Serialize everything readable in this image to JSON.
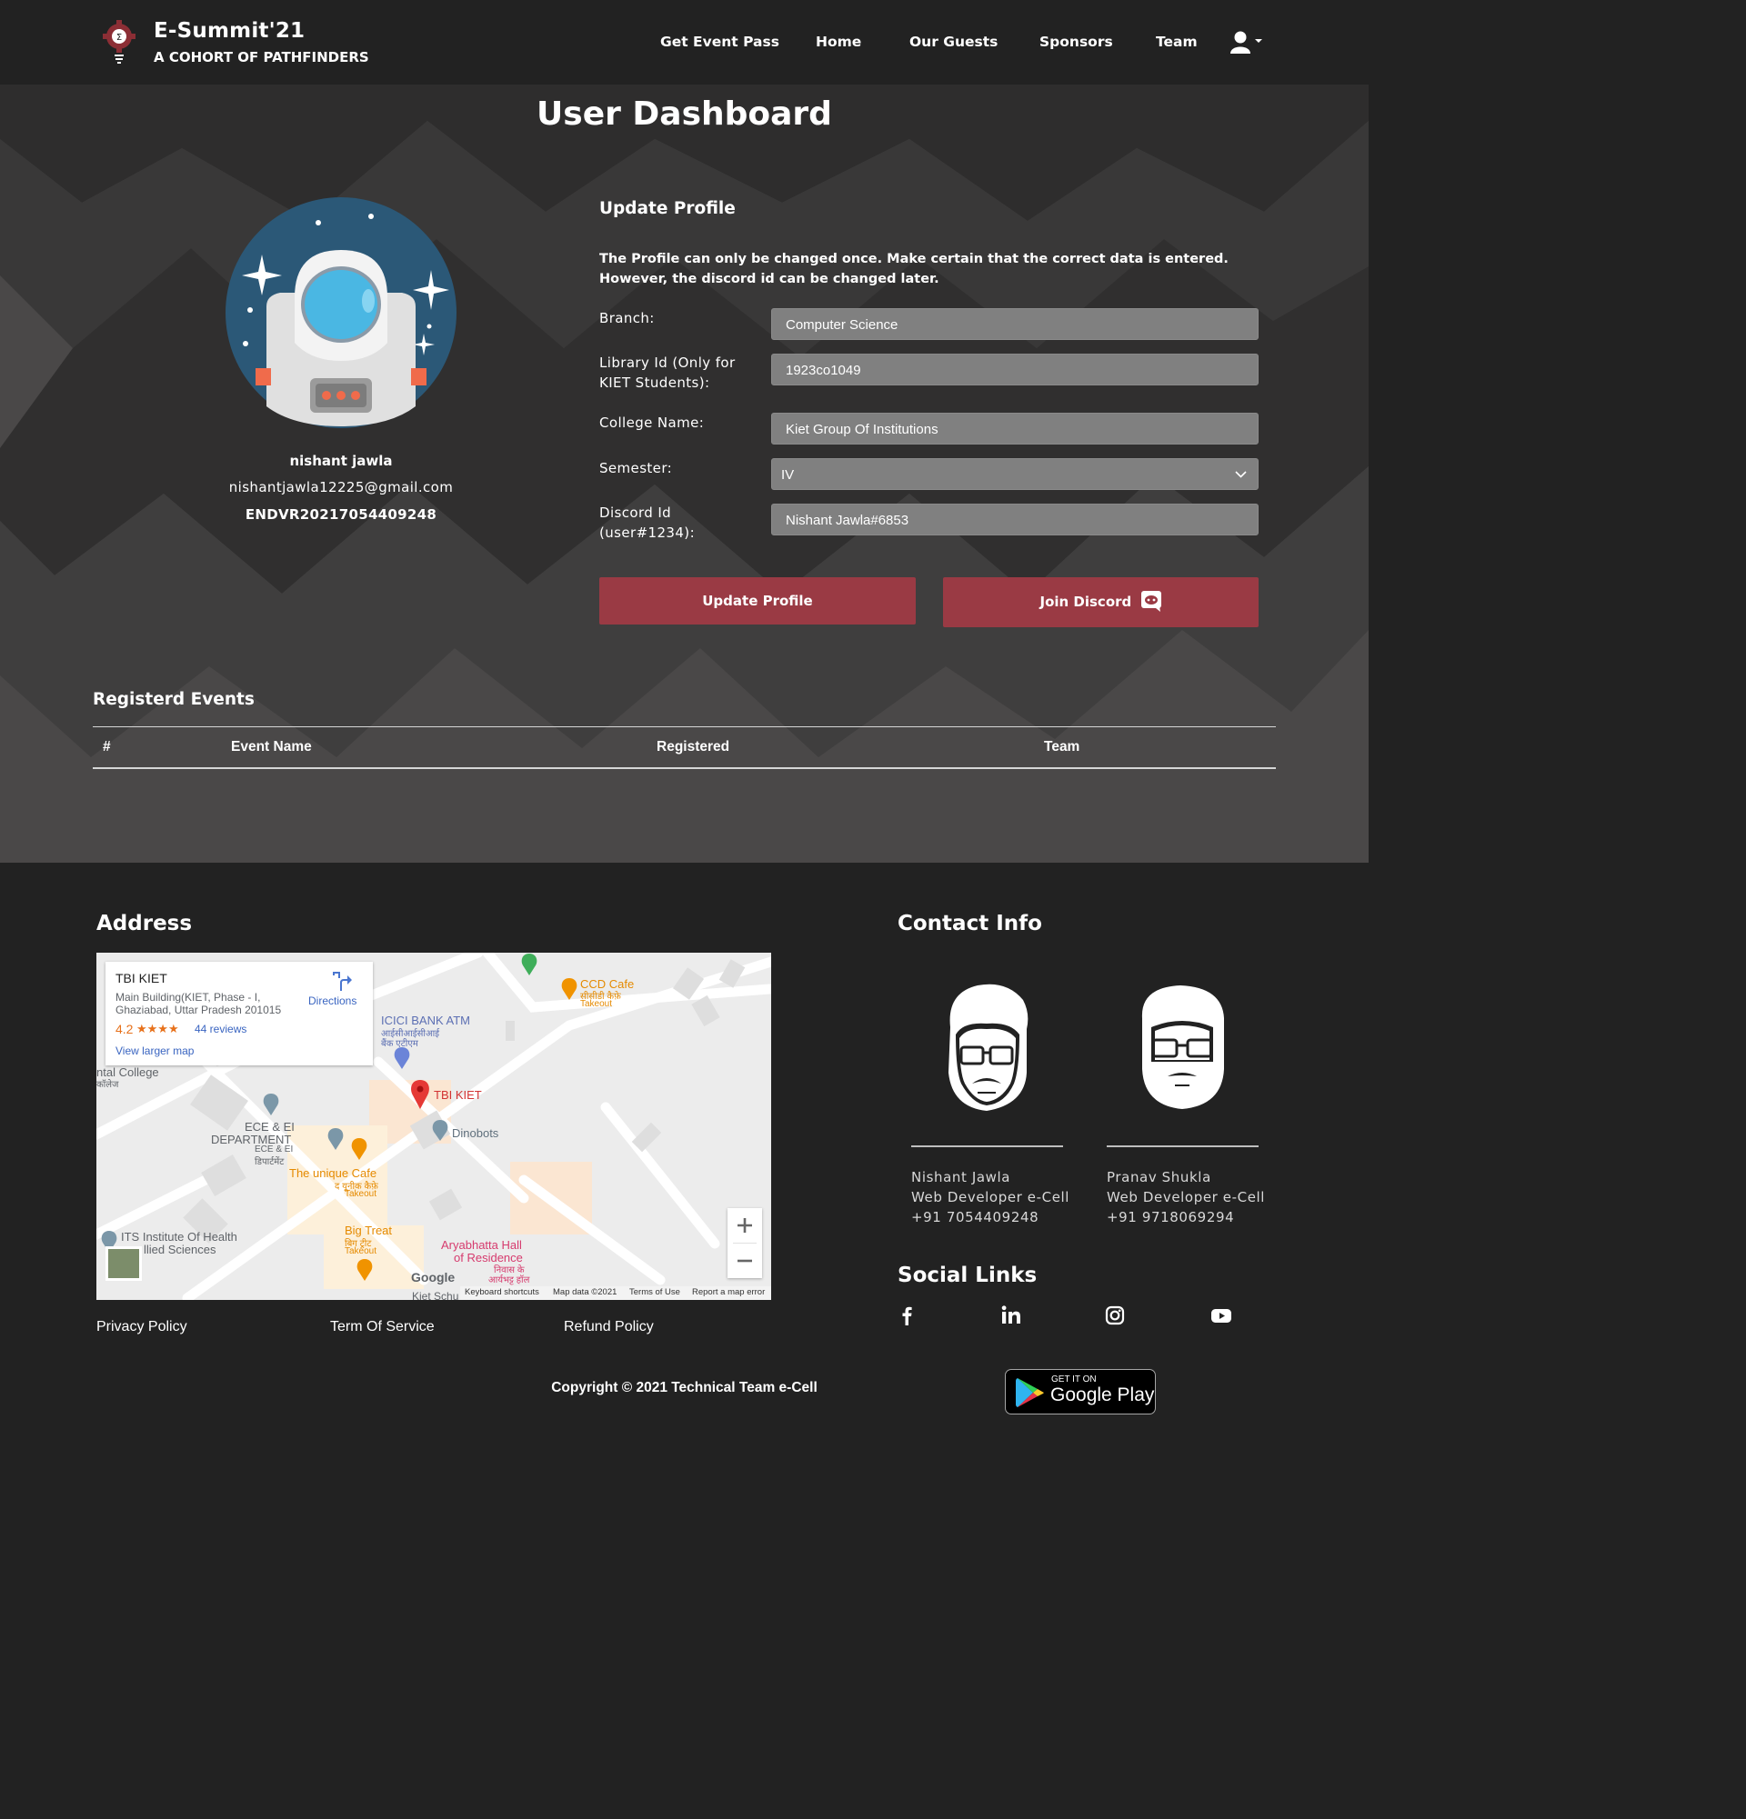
{
  "brand": {
    "title": "E-Summit'21",
    "subtitle": "A COHORT OF PATHFINDERS"
  },
  "nav": {
    "links": [
      "Get Event Pass",
      "Home",
      "Our Guests",
      "Sponsors",
      "Team"
    ]
  },
  "page": {
    "title": "User Dashboard"
  },
  "user": {
    "name": "nishant jawla",
    "email": "nishantjawla12225@gmail.com",
    "code": "ENDVR20217054409248"
  },
  "profile": {
    "heading": "Update Profile",
    "notice": "The Profile can only be changed once. Make certain that the correct data is entered. However, the discord id can be changed later.",
    "fields": [
      {
        "label": "Branch:",
        "value": "Computer Science"
      },
      {
        "label": "Library Id (Only for KIET Students):",
        "value": "1923co1049"
      },
      {
        "label": "College Name:",
        "value": "Kiet Group Of Institutions"
      },
      {
        "label": "Semester:",
        "value": "IV"
      },
      {
        "label": "Discord Id (user#1234):",
        "value": "Nishant Jawla#6853"
      }
    ],
    "update_label": "Update Profile",
    "discord_label": "Join Discord"
  },
  "events": {
    "title": "Registerd Events",
    "columns": [
      "#",
      "Event Name",
      "Registered",
      "Team"
    ],
    "rows": []
  },
  "footer": {
    "address_title": "Address",
    "contact_title": "Contact Info",
    "social_title": "Social Links",
    "links": [
      "Privacy Policy",
      "Term Of Service",
      "Refund Policy"
    ],
    "copyright": "Copyright © 2021 Technical Team e-Cell",
    "contacts": [
      {
        "name": "Nishant Jawla",
        "role": "Web Developer e-Cell",
        "phone": "+91 7054409248"
      },
      {
        "name": "Pranav Shukla",
        "role": "Web Developer e-Cell",
        "phone": "+91 9718069294"
      }
    ],
    "social_icons": [
      "facebook-icon",
      "linkedin-icon",
      "instagram-icon",
      "youtube-icon"
    ],
    "gplay_small": "GET IT ON",
    "gplay_big": "Google Play"
  },
  "map": {
    "place_name": "TBI KIET",
    "address_line1": "Main Building(KIET, Phase - I,",
    "address_line2": "Ghaziabad, Uttar Pradesh 201015",
    "rating": "4.2",
    "stars": "★★★★",
    "reviews": "44 reviews",
    "directions": "Directions",
    "larger_map": "View larger map",
    "labels": {
      "ccd": "CCD Cafe",
      "ccd_hi": "सीसीडी कैफ़े",
      "ccd_take": "Takeout",
      "icici": "ICICI BANK ATM",
      "icici_hi1": "आईसीआईसीआई",
      "icici_hi2": "बैंक एटीएम",
      "tbi": "TBI KIET",
      "dinobots": "Dinobots",
      "college": "ntal College",
      "college_hi": "कॉलेज",
      "ece1": "ECE & EI",
      "ece2": "DEPARTMENT",
      "ece3": "ECE & EI",
      "ece4": "डिपार्टमेंट",
      "cafe": "The unique Cafe",
      "cafe_hi": "द यूनीक कैफ़े",
      "cafe_take": "Takeout",
      "its1": "ITS Institute Of Health",
      "its2": "llied Sciences",
      "bigtreat": "Big Treat",
      "bigtreat_hi": "बिग ट्रीट",
      "bigtreat_take": "Takeout",
      "arya1": "Aryabhatta Hall",
      "arya2": "of Residence",
      "arya_hi1": "निवास के",
      "arya_hi2": "आर्यभट्ट हॉल",
      "kiet_sch": "Kiet Schu",
      "google": "Google",
      "shortcuts": "Keyboard shortcuts",
      "mapdata": "Map data ©2021",
      "terms": "Terms of Use",
      "report": "Report a map error"
    }
  },
  "colors": {
    "accent": "#9a3a44",
    "nav_bg": "#222222",
    "hero_bg": "#4a4848",
    "input_bg": "#808080"
  }
}
